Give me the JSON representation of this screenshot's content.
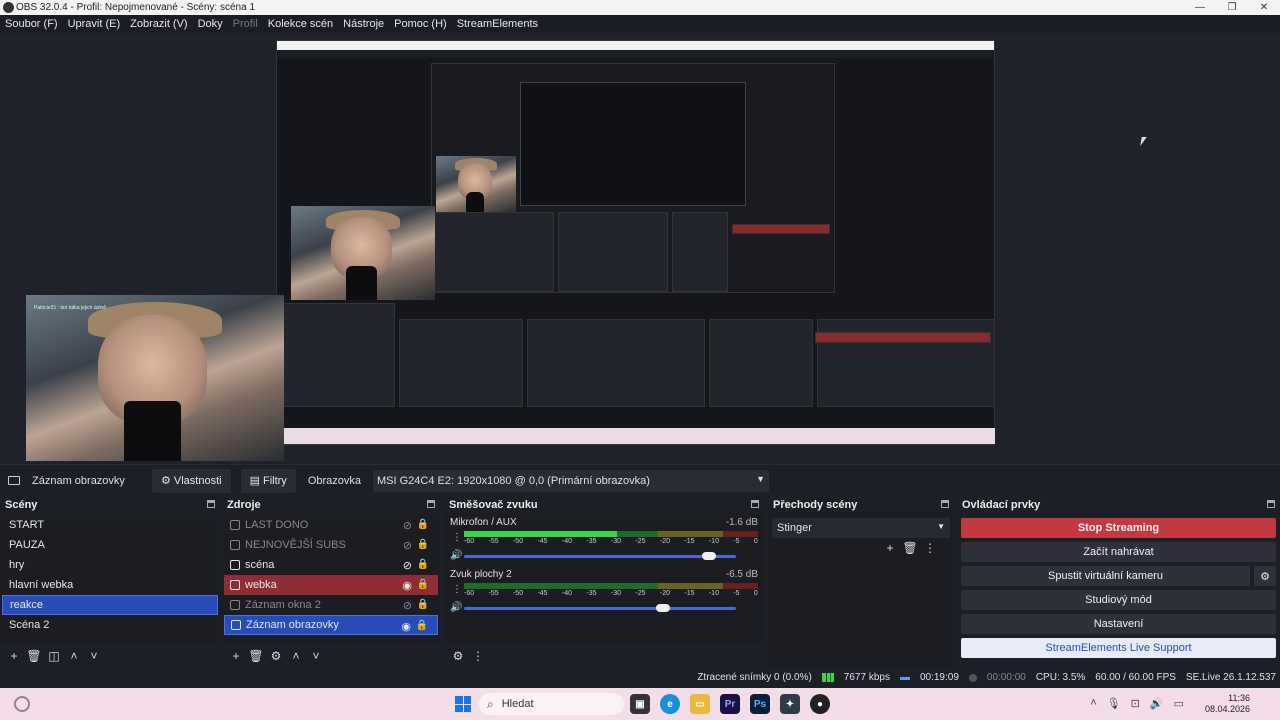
{
  "window": {
    "title": "OBS 32.0.4 - Profil: Nepojmenované - Scény: scéna 1",
    "minimize": "—",
    "maximize": "❐",
    "close": "✕"
  },
  "menu": [
    "Soubor (F)",
    "Upravit (E)",
    "Zobrazit (V)",
    "Doky",
    "Profil",
    "Kolekce scén",
    "Nástroje",
    "Pomoc (H)",
    "StreamElements"
  ],
  "preview": {
    "chat_line": "Patricie31 : ten tatka jejich úplně"
  },
  "source_bar": {
    "source_name": "Záznam obrazovky",
    "properties_label": "Vlastnosti",
    "filters_label": "Filtry",
    "display_label": "Obrazovka",
    "display_value": "MSI G24C4 E2: 1920x1080 @ 0,0 (Primární obrazovka)"
  },
  "scenes": {
    "title": "Scény",
    "items": [
      "START",
      "PAUZA",
      "hry",
      "hlavní webka",
      "reakce",
      "Scéna 2"
    ],
    "selected_index": 4
  },
  "sources": {
    "title": "Zdroje",
    "items": [
      {
        "label": "LAST DONO",
        "state": "hidden"
      },
      {
        "label": "NEJNOVĚJŠÍ SUBS",
        "state": "hidden"
      },
      {
        "label": "scéna",
        "state": "normal"
      },
      {
        "label": "webka",
        "state": "highlight"
      },
      {
        "label": "Záznam okna 2",
        "state": "hidden"
      },
      {
        "label": "Záznam obrazovky",
        "state": "selected"
      }
    ]
  },
  "mixer": {
    "title": "Směšovač zvuku",
    "ticks": [
      "-60",
      "-55",
      "-50",
      "-45",
      "-40",
      "-35",
      "-30",
      "-25",
      "-20",
      "-15",
      "-10",
      "-5",
      "0"
    ],
    "tracks": [
      {
        "name": "Mikrofon / AUX",
        "db": "-1.6 dB",
        "level": 0.52,
        "volume": 0.9
      },
      {
        "name": "Zvuk plochy 2",
        "db": "-6.5 dB",
        "level": 0.0,
        "volume": 0.73
      }
    ]
  },
  "transitions": {
    "title": "Přechody scény",
    "selected": "Stinger"
  },
  "controls": {
    "title": "Ovládací prvky",
    "stop_streaming": "Stop Streaming",
    "start_recording": "Začít nahrávat",
    "virtual_camera": "Spustit virtuální kameru",
    "studio_mode": "Studiový mód",
    "settings": "Nastavení",
    "se_support": "StreamElements Live Support"
  },
  "status": {
    "dropped": "Ztracené snímky 0 (0.0%)",
    "bitrate": "7677 kbps",
    "stream_time": "00:19:09",
    "rec_time": "00:00:00",
    "cpu": "CPU: 3.5%",
    "fps": "60.00 / 60.00 FPS",
    "se_version": "SE.Live 26.1.12.537"
  },
  "taskbar": {
    "search_placeholder": "Hledat",
    "time": "11:36",
    "date": "08.04.2026"
  },
  "colors": {
    "accent": "#284cb8",
    "stop": "#c2393f",
    "webka": "#8f2d36"
  }
}
